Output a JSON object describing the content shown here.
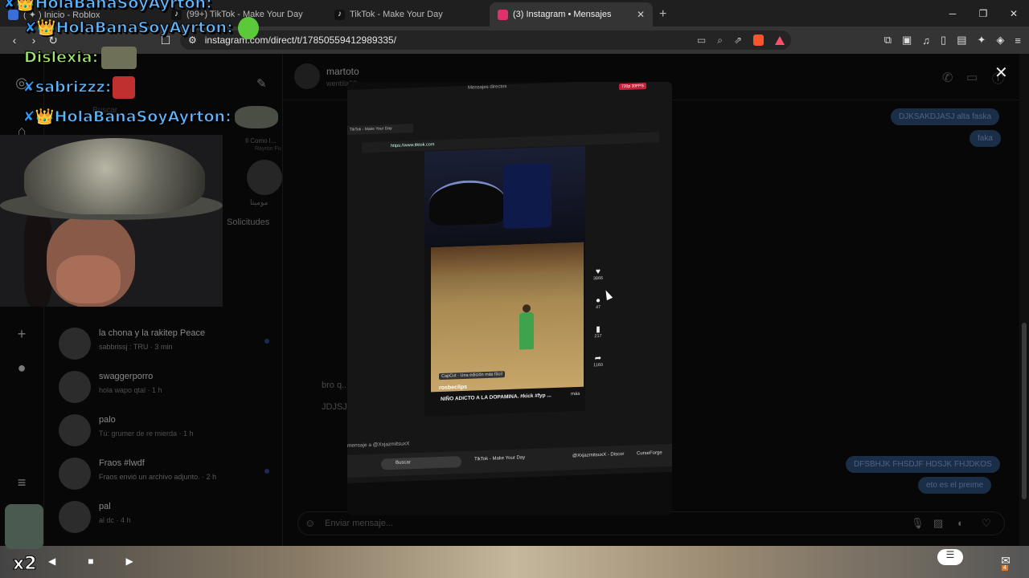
{
  "browser": {
    "tabs": [
      {
        "label": "( ✦ ) Inicio - Roblox",
        "active": false,
        "color": "#3b6fd8"
      },
      {
        "label": "(99+) TikTok - Make Your Day",
        "active": false,
        "color": "#111111"
      },
      {
        "label": "TikTok - Make Your Day",
        "active": false,
        "color": "#111111"
      },
      {
        "label": "(3) Instagram • Mensajes",
        "active": true,
        "color": "#e1306c"
      }
    ],
    "new_tab": "+",
    "url": "instagram.com/direct/t/17850559412989335/",
    "win": {
      "min": "─",
      "max": "❐",
      "close": "✕"
    }
  },
  "stream_chat": [
    {
      "name": "HolaBanaSoyAyrton:",
      "prefix": "✘👑",
      "color": "#5fb7ff"
    },
    {
      "name": "Dislexia:",
      "prefix": "",
      "color": "#9fe86a"
    },
    {
      "name": "sabrizzz:",
      "prefix": "✘",
      "color": "#5fb7ff"
    },
    {
      "name": "HolaBanaSoyAyrton:",
      "prefix": "✘👑",
      "color": "#5fb7ff"
    }
  ],
  "instagram": {
    "requests_label": "Solicitudes",
    "story_label": "موميتا",
    "note_label": "Il Como l...",
    "note_sub": "Rayron Fu",
    "search": "Buscar",
    "conversations": [
      {
        "name": "la chona y la rakitep Peace",
        "preview": "sabbrissj : TRU · 3 min",
        "unread": true
      },
      {
        "name": "swaggerporro",
        "preview": "hola wapo qtal · 1 h",
        "unread": false
      },
      {
        "name": "palo",
        "preview": "Tú: grumer de re mierda · 1 h",
        "unread": false
      },
      {
        "name": "Fraos #lwdf",
        "preview": "Fraos envió un archivo adjunto. · 2 h",
        "unread": true
      },
      {
        "name": "pal",
        "preview": "al dc · 4 h",
        "unread": false
      }
    ],
    "chat": {
      "name": "martoto",
      "handle": "wentila33",
      "messages_right": [
        "DJKSAKDJASJ alta faska",
        "faka",
        "DFSBHJK FHSDJF HDSJK FHJDKOS",
        "eto es el preime"
      ],
      "messages_left": [
        "bro q...",
        "JDJSJ..."
      ],
      "composer_placeholder": "Enviar mensaje..."
    }
  },
  "photo": {
    "window_title": "Mensajes directos",
    "badge": "720p 30FPS",
    "tab_title": "TikTok - Make Your Day",
    "url": "https://www.tiktok.com",
    "video_user": "rosbeclips",
    "video_caption": "NIÑO ADICTO A LA DOPAMINA. #kick #fyp ...",
    "video_more": "más",
    "capcut": "CapCut · Una edición más fácil",
    "likes": "3866",
    "comments": "47",
    "saves": "217",
    "shares": "1160",
    "message_to": "mensaje a @XxjazmitsuxX",
    "taskbar_search": "Buscar",
    "taskbar_items": [
      "TikTok - Make Your Day",
      "@XxjazmitsuxX - Discor",
      "CurseForge"
    ]
  },
  "bottom": {
    "multiplier": "x2",
    "mail_count": "4"
  }
}
